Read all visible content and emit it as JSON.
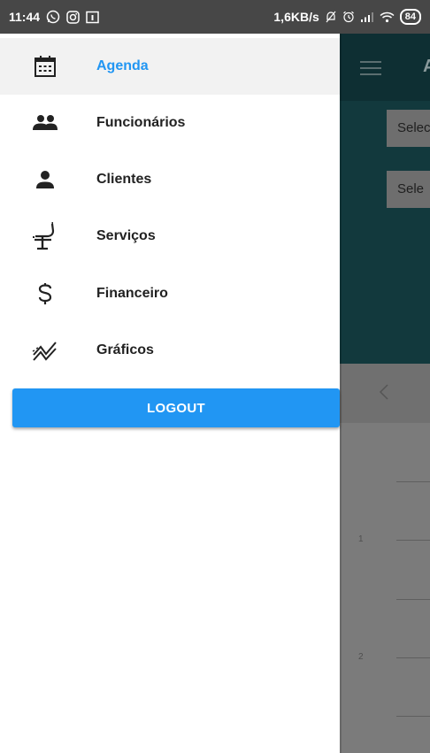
{
  "status_bar": {
    "time": "11:44",
    "network_speed": "1,6KB/s",
    "battery": "84",
    "icons": [
      "whatsapp-icon",
      "instagram-icon",
      "calendar-notification-icon",
      "muted-bell-icon",
      "alarm-icon",
      "signal-icon",
      "wifi-icon",
      "battery-icon"
    ]
  },
  "drawer": {
    "items": [
      {
        "label": "Agenda",
        "icon": "calendar-icon",
        "active": true
      },
      {
        "label": "Funcionários",
        "icon": "people-icon",
        "active": false
      },
      {
        "label": "Clientes",
        "icon": "person-icon",
        "active": false
      },
      {
        "label": "Serviços",
        "icon": "dentist-chair-icon",
        "active": false
      },
      {
        "label": "Financeiro",
        "icon": "dollar-icon",
        "active": false
      },
      {
        "label": "Gráficos",
        "icon": "chart-line-icon",
        "active": false
      }
    ],
    "logout_label": "LOGOUT"
  },
  "background_app": {
    "toolbar_title_initial": "A",
    "select_1": "Selec",
    "select_2": "Sele",
    "row_numbers": [
      "1",
      "2"
    ]
  },
  "colors": {
    "accent": "#2196f3",
    "status_bar": "#474747",
    "drawer_bg": "#ffffff",
    "active_item_bg": "#f2f2f2",
    "header_dim": "#12393d"
  }
}
